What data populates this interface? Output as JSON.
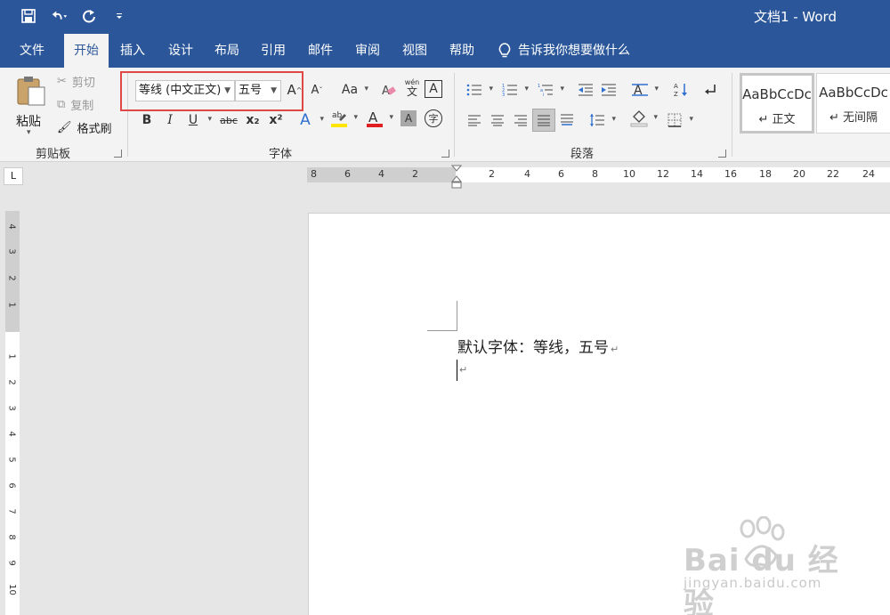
{
  "window": {
    "title": "文档1  -  Word"
  },
  "quick_access": {
    "icons": [
      "save-icon",
      "undo-icon",
      "redo-icon",
      "customize-qat-icon"
    ]
  },
  "tabs": [
    {
      "label": "文件",
      "active": false
    },
    {
      "label": "开始",
      "active": true
    },
    {
      "label": "插入",
      "active": false
    },
    {
      "label": "设计",
      "active": false
    },
    {
      "label": "布局",
      "active": false
    },
    {
      "label": "引用",
      "active": false
    },
    {
      "label": "邮件",
      "active": false
    },
    {
      "label": "审阅",
      "active": false
    },
    {
      "label": "视图",
      "active": false
    },
    {
      "label": "帮助",
      "active": false
    }
  ],
  "tell_me": "告诉我你想要做什么",
  "ribbon": {
    "clipboard": {
      "paste": "粘贴",
      "cut": "剪切",
      "copy": "复制",
      "format_painter": "格式刷",
      "group_label": "剪贴板"
    },
    "font": {
      "font_name": "等线 (中文正文)",
      "font_size": "五号",
      "group_label": "字体",
      "grow": "A",
      "shrink": "A",
      "change_case": "Aa",
      "bold": "B",
      "italic": "I",
      "underline": "U",
      "strikethrough": "abc",
      "subscript": "x₂",
      "superscript": "x²",
      "pinyin": "wén",
      "border_char": "A",
      "enclose": "字"
    },
    "paragraph": {
      "group_label": "段落"
    },
    "styles": [
      {
        "sample": "AaBbCcDc",
        "name": "↵ 正文",
        "selected": true
      },
      {
        "sample": "AaBbCcDc",
        "name": "↵ 无间隔",
        "selected": false
      }
    ]
  },
  "ruler": {
    "horizontal_numbers": [
      "8",
      "6",
      "4",
      "2",
      "2",
      "4",
      "6",
      "8",
      "10",
      "12",
      "14",
      "16",
      "18",
      "20",
      "22",
      "24"
    ],
    "vertical_numbers": [
      "4",
      "3",
      "2",
      "1",
      "1",
      "2",
      "3",
      "4",
      "5",
      "6",
      "7",
      "8",
      "9",
      "10"
    ],
    "tab_stop": "L"
  },
  "document": {
    "line1": "默认字体：等线，五号",
    "paragraph_mark": "↵"
  },
  "watermark": {
    "brand": "Bai du 经验",
    "url": "jingyan.baidu.com"
  },
  "colors": {
    "title_bar": "#2b579a",
    "ribbon": "#f3f3f3",
    "highlight_box": "#e04848",
    "font_color_bar": "#e02020",
    "highlight_color_bar": "#ffe600"
  }
}
